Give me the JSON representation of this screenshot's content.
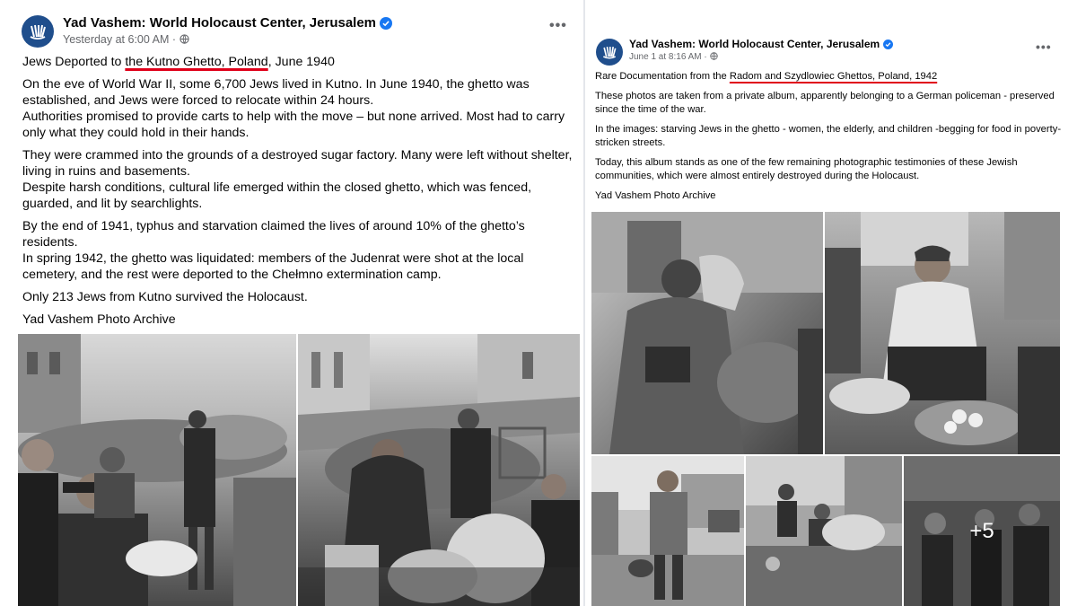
{
  "left_post": {
    "page_name": "Yad Vashem: World Holocaust Center, Jerusalem",
    "timestamp": "Yesterday at 6:00 AM",
    "audience_icon": "globe-icon",
    "more_label": "•••",
    "title_prefix": "Jews Deported to ",
    "title_highlight": "the Kutno Ghetto, Poland",
    "title_suffix": ", June 1940",
    "paragraphs": [
      "On the eve of World War II, some 6,700 Jews lived in Kutno. In June 1940, the ghetto was established, and Jews were forced to relocate within 24 hours.",
      " Authorities promised to provide carts to help with the move – but none arrived. Most had to carry only what they could hold in their hands.",
      "They were crammed into the grounds of a destroyed sugar factory. Many were left without shelter, living in ruins and basements.",
      " Despite harsh conditions, cultural life emerged within the closed ghetto, which was fenced, guarded, and lit by searchlights.",
      "By the end of 1941, typhus and starvation claimed the lives of around 10% of the ghetto’s residents.",
      " In spring 1942, the ghetto was liquidated: members of the Judenrat were shot at the local cemetery, and the rest were deported to the Chełmno extermination camp.",
      "Only 213 Jews from Kutno survived the Holocaust.",
      "Yad Vashem Photo Archive"
    ]
  },
  "right_post": {
    "page_name": "Yad Vashem: World Holocaust Center, Jerusalem",
    "timestamp": "June 1 at 8:16 AM",
    "audience_icon": "globe-icon",
    "more_label": "•••",
    "title_prefix": "Rare Documentation from the ",
    "title_highlight": "Radom and Szydlowiec Ghettos, Poland, 1942",
    "paragraphs": [
      "These photos are taken from a private album, apparently belonging to a German policeman - preserved since the time of the war.",
      "In the images: starving Jews in the ghetto - women, the elderly, and children -begging for food in poverty-stricken streets.",
      "Today, this album stands as one of the few remaining photographic testimonies of these Jewish communities, which were almost entirely destroyed during the Holocaust.",
      "Yad Vashem Photo Archive"
    ],
    "more_photos_label": "+5"
  },
  "colors": {
    "verified": "#1877f2",
    "underline": "#e0001a",
    "meta_text": "#65676b",
    "avatar_bg": "#1f4e8c"
  }
}
